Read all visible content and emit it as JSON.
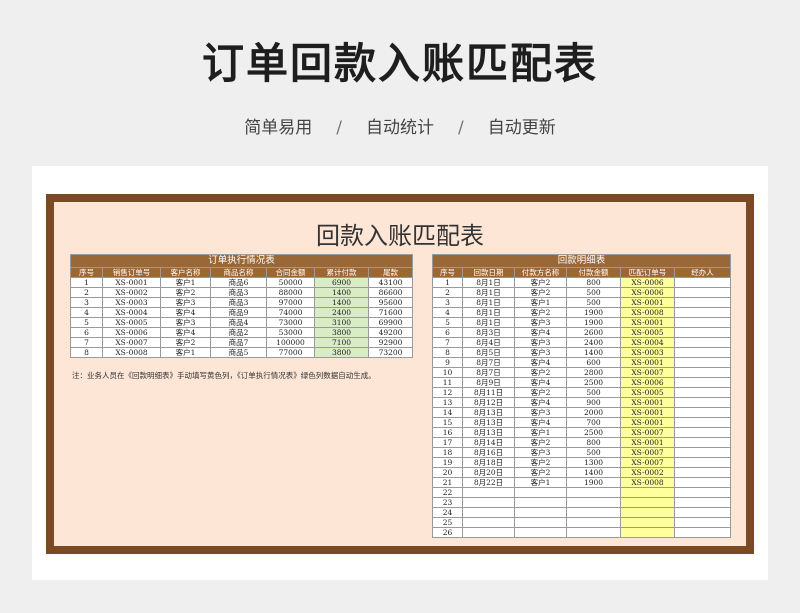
{
  "page": {
    "title": "订单回款入账匹配表",
    "features": [
      "简单易用",
      "自动统计",
      "自动更新"
    ],
    "separator": "/"
  },
  "sheet": {
    "title": "回款入账匹配表",
    "note": "注：业务人员在《回款明细表》手动填写黄色列，《订单执行情况表》绿色列数据自动生成。"
  },
  "colors": {
    "frame": "#7a4b22",
    "header": "#9a6737",
    "sheet_bg": "#fde6d6",
    "auto_col": "#d8ecc6",
    "manual_col": "#ffff9c"
  },
  "orders": {
    "caption": "订单执行情况表",
    "headers": [
      "序号",
      "销售订单号",
      "客户名称",
      "商品名称",
      "合同金额",
      "累计付款",
      "尾款"
    ],
    "rows": [
      [
        "1",
        "XS-0001",
        "客户1",
        "商品6",
        "50000",
        "6900",
        "43100"
      ],
      [
        "2",
        "XS-0002",
        "客户2",
        "商品3",
        "88000",
        "1400",
        "86600"
      ],
      [
        "3",
        "XS-0003",
        "客户3",
        "商品3",
        "97000",
        "1400",
        "95600"
      ],
      [
        "4",
        "XS-0004",
        "客户4",
        "商品9",
        "74000",
        "2400",
        "71600"
      ],
      [
        "5",
        "XS-0005",
        "客户3",
        "商品4",
        "73000",
        "3100",
        "69900"
      ],
      [
        "6",
        "XS-0006",
        "客户4",
        "商品2",
        "53000",
        "3800",
        "49200"
      ],
      [
        "7",
        "XS-0007",
        "客户2",
        "商品7",
        "100000",
        "7100",
        "92900"
      ],
      [
        "8",
        "XS-0008",
        "客户1",
        "商品5",
        "77000",
        "3800",
        "73200"
      ]
    ]
  },
  "payments": {
    "caption": "回款明细表",
    "headers": [
      "序号",
      "回款日期",
      "付款方名称",
      "付款金额",
      "匹配订单号",
      "经办人"
    ],
    "rows": [
      [
        "1",
        "8月1日",
        "客户2",
        "800",
        "XS-0006",
        ""
      ],
      [
        "2",
        "8月1日",
        "客户2",
        "500",
        "XS-0006",
        ""
      ],
      [
        "3",
        "8月1日",
        "客户1",
        "500",
        "XS-0001",
        ""
      ],
      [
        "4",
        "8月1日",
        "客户2",
        "1900",
        "XS-0008",
        ""
      ],
      [
        "5",
        "8月1日",
        "客户3",
        "1900",
        "XS-0001",
        ""
      ],
      [
        "6",
        "8月3日",
        "客户4",
        "2600",
        "XS-0005",
        ""
      ],
      [
        "7",
        "8月4日",
        "客户3",
        "2400",
        "XS-0004",
        ""
      ],
      [
        "8",
        "8月5日",
        "客户3",
        "1400",
        "XS-0003",
        ""
      ],
      [
        "9",
        "8月7日",
        "客户4",
        "600",
        "XS-0001",
        ""
      ],
      [
        "10",
        "8月7日",
        "客户2",
        "2800",
        "XS-0007",
        ""
      ],
      [
        "11",
        "8月9日",
        "客户4",
        "2500",
        "XS-0006",
        ""
      ],
      [
        "12",
        "8月11日",
        "客户2",
        "500",
        "XS-0005",
        ""
      ],
      [
        "13",
        "8月12日",
        "客户4",
        "900",
        "XS-0001",
        ""
      ],
      [
        "14",
        "8月13日",
        "客户3",
        "2000",
        "XS-0001",
        ""
      ],
      [
        "15",
        "8月13日",
        "客户4",
        "700",
        "XS-0001",
        ""
      ],
      [
        "16",
        "8月13日",
        "客户1",
        "2500",
        "XS-0007",
        ""
      ],
      [
        "17",
        "8月14日",
        "客户2",
        "800",
        "XS-0001",
        ""
      ],
      [
        "18",
        "8月16日",
        "客户3",
        "500",
        "XS-0007",
        ""
      ],
      [
        "19",
        "8月18日",
        "客户2",
        "1300",
        "XS-0007",
        ""
      ],
      [
        "20",
        "8月20日",
        "客户2",
        "1400",
        "XS-0002",
        ""
      ],
      [
        "21",
        "8月22日",
        "客户1",
        "1900",
        "XS-0008",
        ""
      ],
      [
        "22",
        "",
        "",
        "",
        "",
        ""
      ],
      [
        "23",
        "",
        "",
        "",
        "",
        ""
      ],
      [
        "24",
        "",
        "",
        "",
        "",
        ""
      ],
      [
        "25",
        "",
        "",
        "",
        "",
        ""
      ],
      [
        "26",
        "",
        "",
        "",
        "",
        ""
      ]
    ]
  }
}
